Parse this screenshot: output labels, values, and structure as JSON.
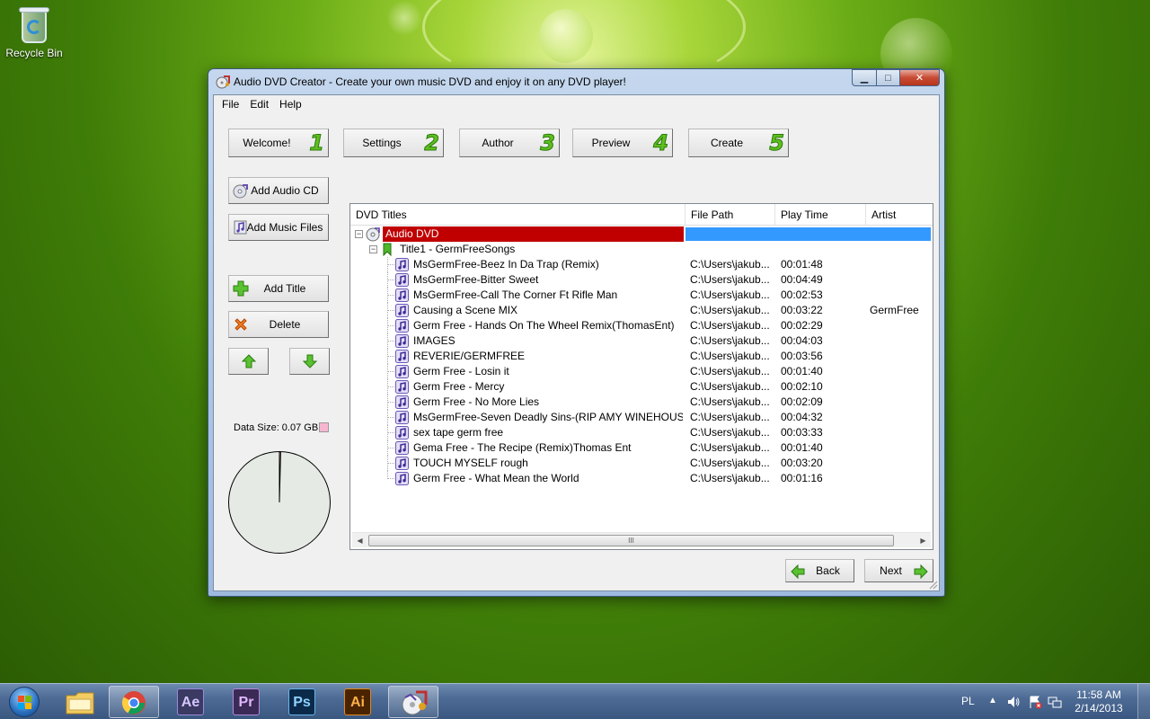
{
  "desktop": {
    "icons": [
      {
        "label": "Recycle Bin",
        "icon": "recycle-bin-icon"
      }
    ]
  },
  "window": {
    "title": "Audio DVD Creator - Create your own music DVD and enjoy it on any DVD player!",
    "controls": {
      "minimize": "minimize",
      "maximize": "maximize",
      "close": "close"
    },
    "menu": [
      "File",
      "Edit",
      "Help"
    ],
    "steps": [
      {
        "label": "Welcome!",
        "num": "1"
      },
      {
        "label": "Settings",
        "num": "2"
      },
      {
        "label": "Author",
        "num": "3"
      },
      {
        "label": "Preview",
        "num": "4"
      },
      {
        "label": "Create",
        "num": "5"
      }
    ],
    "side_buttons": {
      "add_audio_cd": "Add Audio CD",
      "add_music_files": "Add Music Files",
      "add_title": "Add Title",
      "delete": "Delete",
      "move_up": "up-arrow-icon",
      "move_down": "down-arrow-icon"
    },
    "data_size": {
      "label": "Data Size: 0.07 GB",
      "fraction": 0.004,
      "legend_color": "#f7b6d0"
    },
    "tree": {
      "columns": [
        "DVD Titles",
        "File Path",
        "Play Time",
        "Artist"
      ],
      "root": {
        "label": "Audio DVD",
        "highlight": "#c00000",
        "selection": "#3399ff"
      },
      "title_node": {
        "label": "Title1 - GermFreeSongs"
      },
      "tracks": [
        {
          "title": "MsGermFree-Beez In Da Trap (Remix)",
          "path": "C:\\Users\\jakub...",
          "time": "00:01:48",
          "artist": ""
        },
        {
          "title": "MsGermFree-Bitter Sweet",
          "path": "C:\\Users\\jakub...",
          "time": "00:04:49",
          "artist": ""
        },
        {
          "title": "MsGermFree-Call The Corner  Ft Rifle Man",
          "path": "C:\\Users\\jakub...",
          "time": "00:02:53",
          "artist": ""
        },
        {
          "title": "Causing a Scene MIX",
          "path": "C:\\Users\\jakub...",
          "time": "00:03:22",
          "artist": "GermFree"
        },
        {
          "title": "Germ Free - Hands On The Wheel Remix(ThomasEnt)",
          "path": "C:\\Users\\jakub...",
          "time": "00:02:29",
          "artist": ""
        },
        {
          "title": "IMAGES",
          "path": "C:\\Users\\jakub...",
          "time": "00:04:03",
          "artist": ""
        },
        {
          "title": "REVERIE/GERMFREE",
          "path": "C:\\Users\\jakub...",
          "time": "00:03:56",
          "artist": ""
        },
        {
          "title": "Germ Free - Losin it",
          "path": "C:\\Users\\jakub...",
          "time": "00:01:40",
          "artist": ""
        },
        {
          "title": "Germ Free - Mercy",
          "path": "C:\\Users\\jakub...",
          "time": "00:02:10",
          "artist": ""
        },
        {
          "title": "Germ Free - No More Lies",
          "path": "C:\\Users\\jakub...",
          "time": "00:02:09",
          "artist": ""
        },
        {
          "title": "MsGermFree-Seven Deadly Sins-(RIP AMY WINEHOUSE) V...",
          "path": "C:\\Users\\jakub...",
          "time": "00:04:32",
          "artist": ""
        },
        {
          "title": "sex tape germ free",
          "path": "C:\\Users\\jakub...",
          "time": "00:03:33",
          "artist": ""
        },
        {
          "title": "Gema Free - The Recipe (Remix)Thomas Ent",
          "path": "C:\\Users\\jakub...",
          "time": "00:01:40",
          "artist": ""
        },
        {
          "title": "TOUCH MYSELF rough",
          "path": "C:\\Users\\jakub...",
          "time": "00:03:20",
          "artist": ""
        },
        {
          "title": "Germ Free - What Mean the World",
          "path": "C:\\Users\\jakub...",
          "time": "00:01:16",
          "artist": ""
        }
      ],
      "scroll_grip": "III"
    },
    "nav": {
      "back": "Back",
      "next": "Next"
    }
  },
  "taskbar": {
    "apps": [
      {
        "name": "Windows Explorer",
        "icon": "folder-icon"
      },
      {
        "name": "Google Chrome",
        "icon": "chrome-icon"
      },
      {
        "name": "After Effects",
        "glyph": "Ae",
        "icon": "after-effects-icon"
      },
      {
        "name": "Premiere",
        "glyph": "Pr",
        "icon": "premiere-icon"
      },
      {
        "name": "Photoshop",
        "glyph": "Ps",
        "icon": "photoshop-icon"
      },
      {
        "name": "Illustrator",
        "glyph": "Ai",
        "icon": "illustrator-icon"
      },
      {
        "name": "Audio DVD Creator",
        "icon": "audio-dvd-creator-icon"
      }
    ],
    "language": "PL",
    "time": "11:58 AM",
    "date": "2/14/2013"
  }
}
